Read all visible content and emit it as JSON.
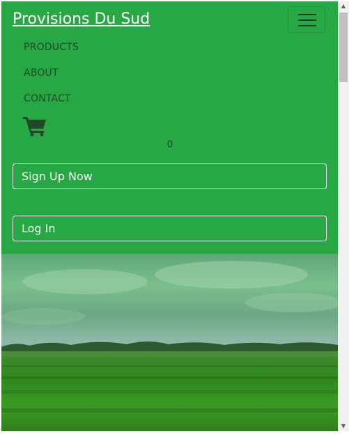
{
  "navbar": {
    "brand": "Provisions Du Sud",
    "links": [
      {
        "label": "PRODUCTS"
      },
      {
        "label": "ABOUT"
      },
      {
        "label": "CONTACT"
      }
    ],
    "cart_count": "0",
    "cart_icon": "shopping-cart-icon",
    "toggler_icon": "hamburger-menu-icon",
    "signup_label": "Sign Up Now",
    "login_label": "Log In"
  },
  "hero": {
    "image": "green-field-landscape"
  },
  "colors": {
    "navbar_bg": "#28a745",
    "nav_text": "#1f4a2a",
    "button_border": "#ffffff"
  }
}
